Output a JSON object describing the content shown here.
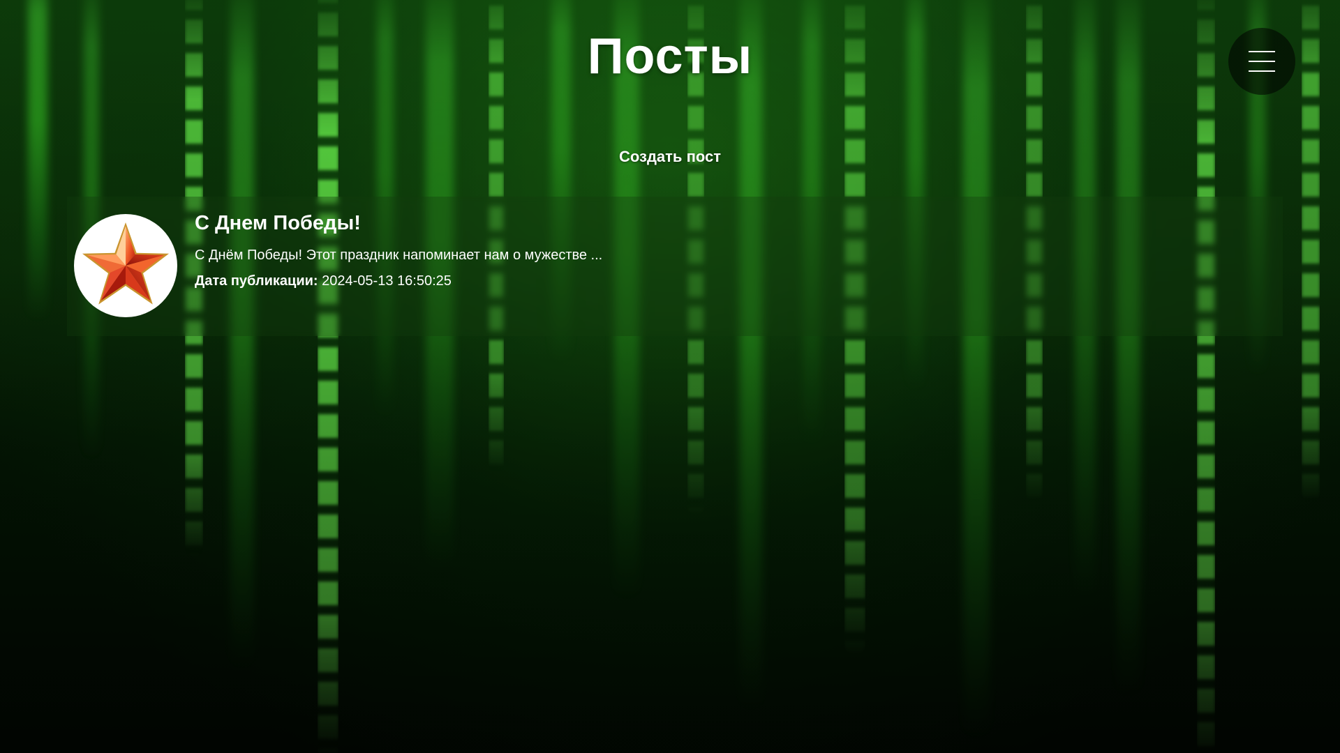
{
  "header": {
    "title": "Посты",
    "menu_icon": "hamburger-menu-icon"
  },
  "actions": {
    "create_post_label": "Создать пост"
  },
  "posts": [
    {
      "title": "С Днем Победы!",
      "excerpt": "С Днём Победы! Этот праздник напоминает нам о мужестве ...",
      "date_label": "Дата публикации:",
      "date_value": "2024-05-13 16:50:25",
      "image_icon": "red-star-icon"
    }
  ],
  "colors": {
    "background": "#0a2d08",
    "matrix_green": "#50ff3c",
    "text": "#ffffff",
    "star_red": "#e53a1e"
  }
}
